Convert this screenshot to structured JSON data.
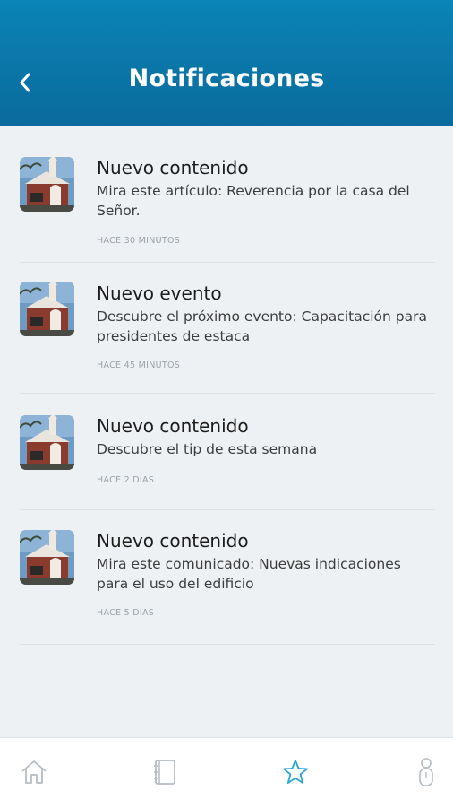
{
  "header": {
    "title": "Notificaciones",
    "back_icon": "chevron-left-icon"
  },
  "notifications": [
    {
      "title": "Nuevo contenido",
      "description": "Mira este artículo: Reverencia por la casa del Señor.",
      "time": "HACE 30 MINUTOS"
    },
    {
      "title": "Nuevo evento",
      "description": "Descubre el próximo evento: Capacitación para presidentes de estaca",
      "time": "HACE 45 MINUTOS"
    },
    {
      "title": "Nuevo contenido",
      "description": "Descubre el tip de esta semana",
      "time": "HACE 2 DÍAS"
    },
    {
      "title": "Nuevo contenido",
      "description": "Mira este comunicado: Nuevas indicaciones para el uso del edificio",
      "time": "HACE 5 DÍAS"
    }
  ],
  "tabbar": {
    "items": [
      {
        "icon": "home-icon",
        "active": false
      },
      {
        "icon": "notebook-icon",
        "active": false
      },
      {
        "icon": "star-icon",
        "active": true
      },
      {
        "icon": "person-icon",
        "active": false
      }
    ]
  },
  "colors": {
    "header": "#0a84b6",
    "active_tab": "#2aa6d4",
    "inactive_tab": "#b5bcc2"
  }
}
